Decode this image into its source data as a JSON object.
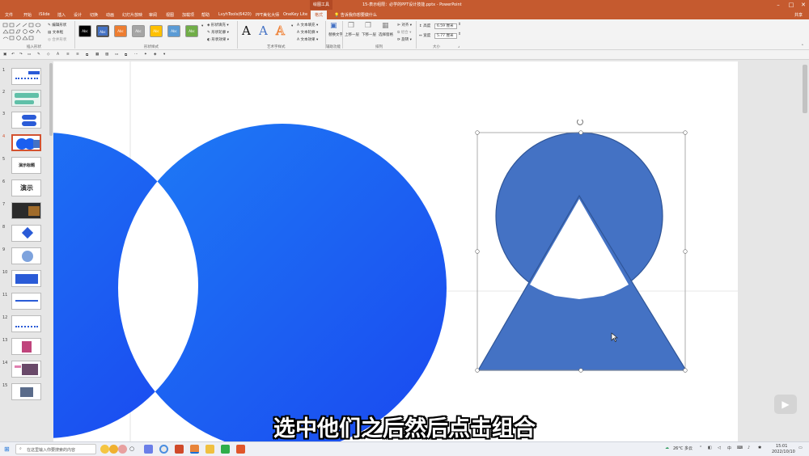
{
  "titlebar": {
    "context_tab": "绘图工具",
    "document_title": "15-表示组限：必学的PPT设计技能.pptx  -  PowerPoint",
    "min_icon": "minimize-icon",
    "max_icon": "maximize-icon",
    "close_icon": "close-icon"
  },
  "tabs": [
    "文件",
    "开始",
    "iSlide",
    "插入",
    "设计",
    "切换",
    "动画",
    "幻灯片放映",
    "审阅",
    "视图",
    "加载项",
    "帮助",
    "LvyhTools(6420)",
    "PPT美化大师",
    "OneKey Lite",
    "格式"
  ],
  "active_tab": "格式",
  "tell_me": "告诉我你想要做什么",
  "share": "共享",
  "ribbon": {
    "insert_shapes": {
      "label": "插入形状",
      "edit_shape": "编辑形状",
      "text_box": "文本框",
      "merge_shapes": "合并形状"
    },
    "shape_styles": {
      "label": "形状样式",
      "swatches": [
        {
          "text": "Abc",
          "color": "#000000"
        },
        {
          "text": "Abc",
          "color": "#4472c4"
        },
        {
          "text": "Abc",
          "color": "#ed7d31"
        },
        {
          "text": "Abc",
          "color": "#a5a5a5"
        },
        {
          "text": "Abc",
          "color": "#ffc000"
        },
        {
          "text": "Abc",
          "color": "#5b9bd5"
        },
        {
          "text": "Abc",
          "color": "#70ad47"
        }
      ],
      "fill": "形状填充",
      "outline": "形状轮廓",
      "effects": "形状效果"
    },
    "wordart": {
      "label": "艺术字样式",
      "letters": [
        "A",
        "A",
        "A"
      ],
      "text_fill": "文本填充",
      "text_outline": "文本轮廓",
      "text_effects": "文本效果"
    },
    "accessibility": {
      "label": "辅助功能",
      "alt_text": "替换文字"
    },
    "arrange": {
      "label": "排列",
      "bring_forward": "上移一层",
      "send_backward": "下移一层",
      "selection_pane": "选择窗格",
      "align": "对齐",
      "group": "组合",
      "rotate": "旋转"
    },
    "size": {
      "label": "大小",
      "height_label": "高度",
      "height_value": "6.59 厘米",
      "width_label": "宽度",
      "width_value": "5.77 厘米"
    }
  },
  "thumbnails": [
    "1",
    "2",
    "3",
    "4",
    "5",
    "6",
    "7",
    "8",
    "9",
    "10",
    "11",
    "12",
    "13",
    "14",
    "15"
  ],
  "selected_slide": 4,
  "thumb_texts": {
    "t6": "演示",
    "t5": "演示标题"
  },
  "subtitle": "选中他们之后然后点击组合",
  "taskbar": {
    "search_placeholder": "在这里输入你要搜索的内容",
    "weather": "26°C  多云",
    "time": "15:01",
    "date": "2022/10/10"
  },
  "colors": {
    "accent": "#c55a2f",
    "shape_fill": "#4472c4",
    "circle_gradient_start": "#1e7cf5",
    "circle_gradient_end": "#1a48f0"
  }
}
